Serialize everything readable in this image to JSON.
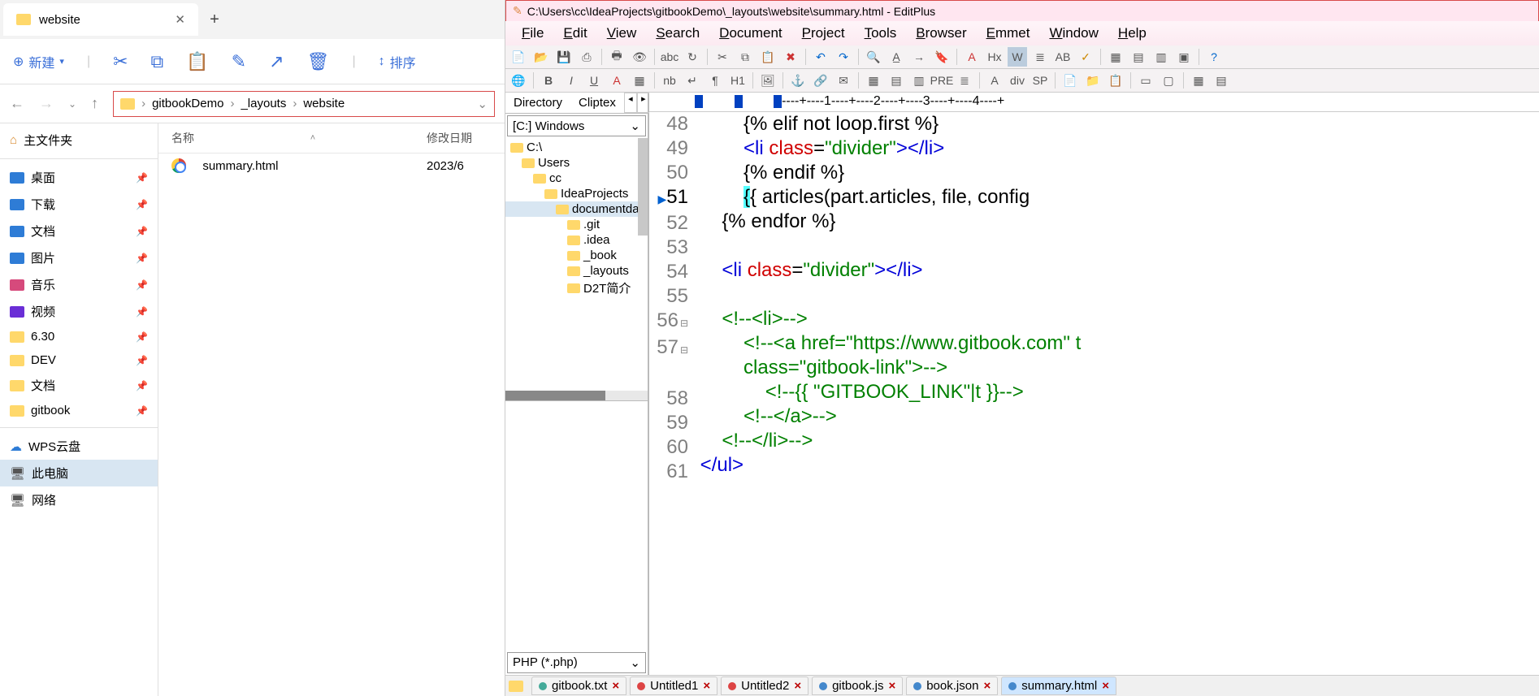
{
  "explorer": {
    "tab_title": "website",
    "new_btn": "新建",
    "sort_btn": "排序",
    "breadcrumb": [
      "gitbookDemo",
      "_layouts",
      "website"
    ],
    "columns": {
      "name": "名称",
      "date": "修改日期"
    },
    "home_label": "主文件夹",
    "sidebar": [
      {
        "label": "桌面",
        "color": "#2e7cd6"
      },
      {
        "label": "下载",
        "color": "#2e7cd6"
      },
      {
        "label": "文档",
        "color": "#2e7cd6"
      },
      {
        "label": "图片",
        "color": "#2e7cd6"
      },
      {
        "label": "音乐",
        "color": "#d64a7c"
      },
      {
        "label": "视频",
        "color": "#6a2ed6"
      },
      {
        "label": "6.30",
        "color": "#ffd86b"
      },
      {
        "label": "DEV",
        "color": "#ffd86b"
      },
      {
        "label": "文档",
        "color": "#ffd86b"
      },
      {
        "label": "gitbook",
        "color": "#ffd86b"
      }
    ],
    "sidebar2": [
      {
        "label": "WPS云盘",
        "icon": "☁",
        "color": "#2e7cd6"
      },
      {
        "label": "此电脑",
        "icon": "🖥",
        "sel": true
      },
      {
        "label": "网络",
        "icon": "🖥"
      }
    ],
    "files": [
      {
        "name": "summary.html",
        "date": "2023/6"
      }
    ]
  },
  "editor": {
    "title_path": "C:\\Users\\cc\\IdeaProjects\\gitbookDemo\\_layouts\\website\\summary.html - EditPlus",
    "menu": [
      "File",
      "Edit",
      "View",
      "Search",
      "Document",
      "Project",
      "Tools",
      "Browser",
      "Emmet",
      "Window",
      "Help"
    ],
    "side_tabs": [
      "Directory",
      "Cliptex"
    ],
    "drive": "[C:] Windows",
    "tree": [
      {
        "label": "C:\\",
        "indent": 0
      },
      {
        "label": "Users",
        "indent": 1
      },
      {
        "label": "cc",
        "indent": 2
      },
      {
        "label": "IdeaProjects",
        "indent": 3
      },
      {
        "label": "documentda",
        "indent": 4,
        "sel": true
      },
      {
        "label": ".git",
        "indent": 5
      },
      {
        "label": ".idea",
        "indent": 5
      },
      {
        "label": "_book",
        "indent": 5
      },
      {
        "label": "_layouts",
        "indent": 5
      },
      {
        "label": "D2T简介",
        "indent": 5
      }
    ],
    "filetype": "PHP (*.php)",
    "ruler": "----+----1----+----2----+----3----+----4----+",
    "lines": [
      {
        "n": 48,
        "html": "         {% elif not loop.first %}"
      },
      {
        "n": 49,
        "html": "         <span class='kw-tag'>&lt;li</span> <span class='kw-attr'>class</span>=<span class='kw-str'>\"divider\"</span><span class='kw-tag'>&gt;&lt;/li&gt;</span>"
      },
      {
        "n": 50,
        "html": "         {% endif %}"
      },
      {
        "n": 51,
        "html": "         <span class='hl'>{</span>{ articles(part.articles, file, config",
        "cur": true
      },
      {
        "n": 52,
        "html": "     {% endfor %}"
      },
      {
        "n": 53,
        "html": ""
      },
      {
        "n": 54,
        "html": "     <span class='kw-tag'>&lt;li</span> <span class='kw-attr'>class</span>=<span class='kw-str'>\"divider\"</span><span class='kw-tag'>&gt;&lt;/li&gt;</span>"
      },
      {
        "n": 55,
        "html": ""
      },
      {
        "n": 56,
        "html": "     <span class='kw-cmt'>&lt;!--&lt;li&gt;--&gt;</span>",
        "fold": true
      },
      {
        "n": 57,
        "html": "         <span class='kw-cmt'>&lt;!--&lt;a href=\"https://www.gitbook.com\" t</span>",
        "fold": true
      },
      {
        "n": "",
        "html": "         <span class='kw-cmt'>class=\"gitbook-link\"&gt;--&gt;</span>"
      },
      {
        "n": 58,
        "html": "             <span class='kw-cmt'>&lt;!--{{ \"GITBOOK_LINK\"|t }}--&gt;</span>"
      },
      {
        "n": 59,
        "html": "         <span class='kw-cmt'>&lt;!--&lt;/a&gt;--&gt;</span>"
      },
      {
        "n": 60,
        "html": "     <span class='kw-cmt'>&lt;!--&lt;/li&gt;--&gt;</span>"
      },
      {
        "n": 61,
        "html": " <span class='kw-tag'>&lt;/ul&gt;</span>"
      }
    ],
    "doctabs": [
      {
        "label": "gitbook.txt",
        "color": "#4a9"
      },
      {
        "label": "Untitled1",
        "color": "#d44"
      },
      {
        "label": "Untitled2",
        "color": "#d44"
      },
      {
        "label": "gitbook.js",
        "color": "#48c"
      },
      {
        "label": "book.json",
        "color": "#48c"
      },
      {
        "label": "summary.html",
        "color": "#48c",
        "active": true
      }
    ]
  }
}
